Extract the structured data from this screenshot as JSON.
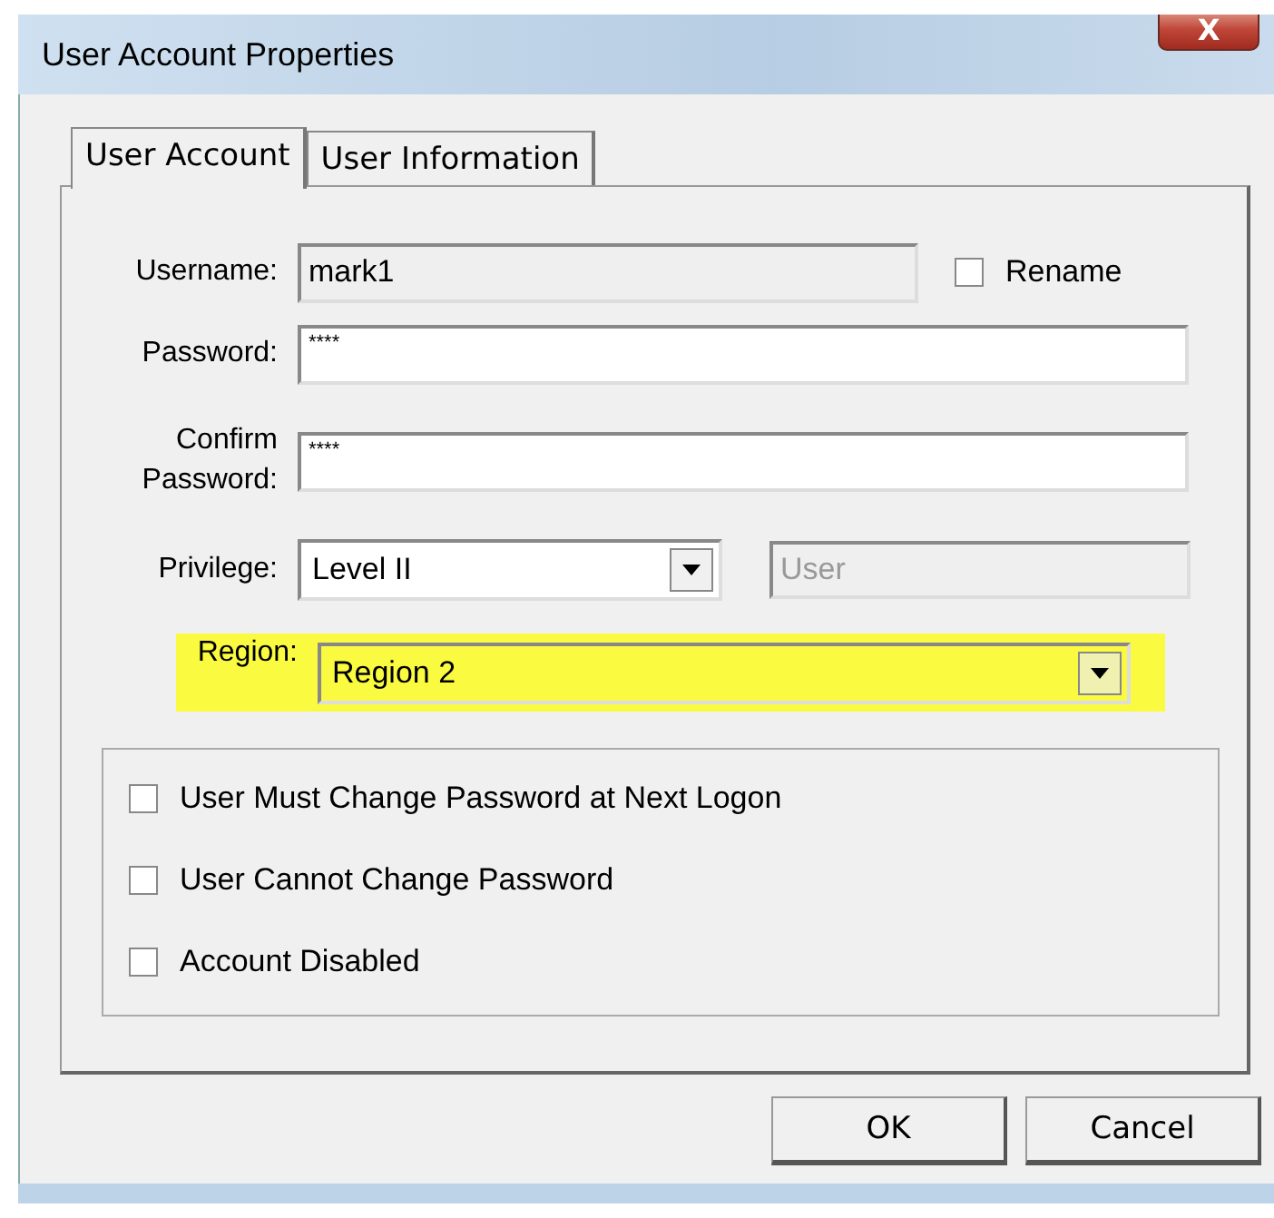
{
  "window": {
    "title": "User Account Properties",
    "close": "X"
  },
  "tabs": [
    {
      "label": "User Account",
      "selected": true
    },
    {
      "label": "User Information",
      "selected": false
    }
  ],
  "username": {
    "label": "Username:",
    "value": "mark1",
    "disabled": true,
    "rename": {
      "label": "Rename",
      "checked": false
    }
  },
  "password": {
    "label": "Password:",
    "value": "****"
  },
  "confirm": {
    "label": "Confirm Password:",
    "value": "****"
  },
  "privilege": {
    "label": "Privilege:",
    "value": "Level II",
    "role": "User",
    "role_disabled": true
  },
  "region": {
    "label": "Region:",
    "value": "Region 2",
    "highlighted": true
  },
  "options": [
    {
      "label": "User Must Change Password at Next Logon",
      "checked": false
    },
    {
      "label": "User Cannot Change Password",
      "checked": false
    },
    {
      "label": "Account Disabled",
      "checked": false
    }
  ],
  "buttons": [
    "OK",
    "Cancel"
  ]
}
